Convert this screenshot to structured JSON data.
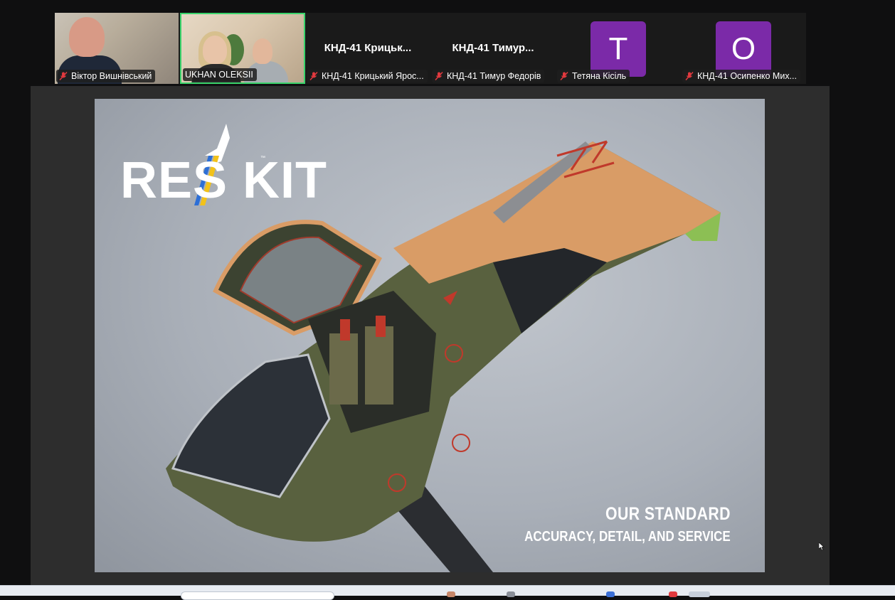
{
  "participants": [
    {
      "type": "video",
      "label": "Віктор Вишнівський",
      "muted": true
    },
    {
      "type": "video",
      "label": "UKHAN OLEKSII",
      "muted": false,
      "active_speaker": true
    },
    {
      "type": "name",
      "display": "КНД-41  Крицьк...",
      "label": "КНД-41 Крицький Ярос...",
      "muted": true
    },
    {
      "type": "name",
      "display": "КНД-41  Тимур...",
      "label": "КНД-41 Тимур Федорів",
      "muted": true
    },
    {
      "type": "avatar",
      "initial": "T",
      "label": "Тетяна Кісіль",
      "muted": true
    },
    {
      "type": "avatar",
      "initial": "O",
      "label": "КНД-41 Осипенко Мих...",
      "muted": true
    }
  ],
  "slide": {
    "logo": "RES KIT",
    "logo_trademark": "™",
    "headline": "OUR STANDARD",
    "subheadline": "ACCURACY, DETAIL, AND SERVICE"
  },
  "colors": {
    "active_speaker_border": "#3ad36b",
    "avatar_bg": "#7b2aa8",
    "muted_icon": "#e0393e"
  }
}
